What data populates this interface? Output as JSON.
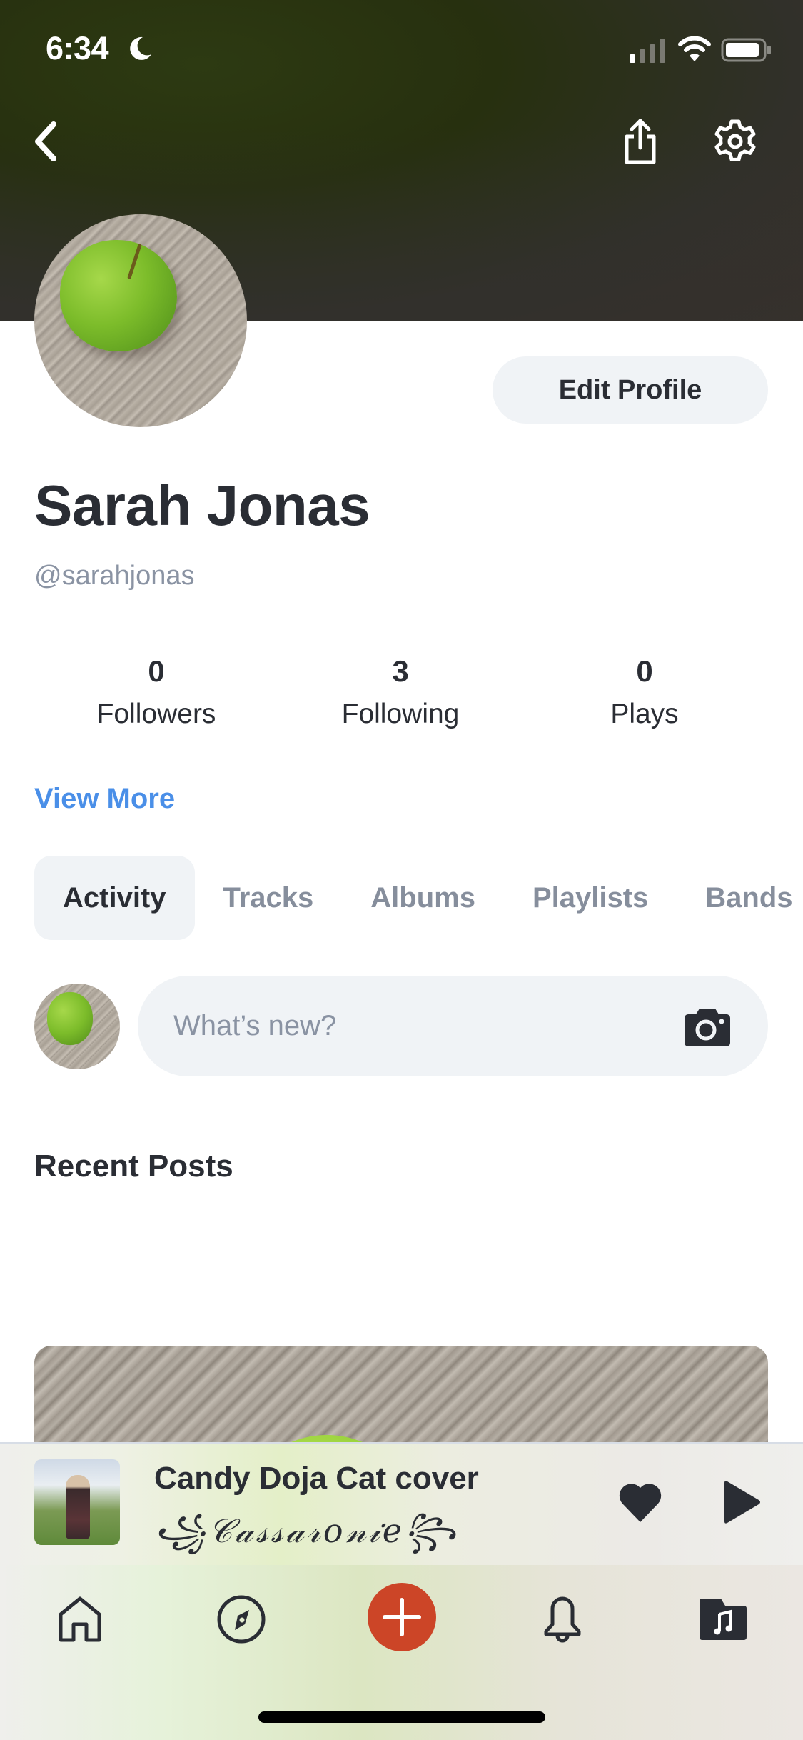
{
  "status_bar": {
    "time": "6:34",
    "icons": [
      "moon-icon",
      "cellular-signal-icon",
      "wifi-icon",
      "battery-icon"
    ]
  },
  "header": {
    "back_icon": "chevron-left-icon",
    "share_icon": "share-icon",
    "settings_icon": "gear-icon"
  },
  "profile": {
    "name": "Sarah Jonas",
    "handle": "@sarahjonas",
    "edit_button_label": "Edit Profile",
    "stats": [
      {
        "value": "0",
        "label": "Followers"
      },
      {
        "value": "3",
        "label": "Following"
      },
      {
        "value": "0",
        "label": "Plays"
      }
    ],
    "view_more_label": "View More"
  },
  "tabs": [
    {
      "label": "Activity",
      "active": true
    },
    {
      "label": "Tracks",
      "active": false
    },
    {
      "label": "Albums",
      "active": false
    },
    {
      "label": "Playlists",
      "active": false
    },
    {
      "label": "Bands",
      "active": false
    }
  ],
  "composer": {
    "placeholder": "What’s new?",
    "value": "",
    "camera_icon": "camera-icon"
  },
  "recent_posts": {
    "title": "Recent Posts"
  },
  "now_playing": {
    "title": "Candy Doja Cat cover",
    "artist": "꧁𝒞𝒶𝓈𝓈𝒶𝓇𝑜𝓃𝒾𝑒꧂",
    "like_icon": "heart-icon",
    "play_icon": "play-icon"
  },
  "bottom_nav": [
    {
      "name": "home",
      "icon": "home-icon"
    },
    {
      "name": "explore",
      "icon": "compass-icon"
    },
    {
      "name": "create",
      "icon": "plus-icon"
    },
    {
      "name": "notifications",
      "icon": "bell-icon"
    },
    {
      "name": "library",
      "icon": "music-folder-icon"
    }
  ],
  "colors": {
    "accent_link": "#4a8fe8",
    "create_button": "#cc4527",
    "text_primary": "#2a2d34",
    "text_secondary": "#8a93a3",
    "chip_bg": "#f0f3f6"
  }
}
